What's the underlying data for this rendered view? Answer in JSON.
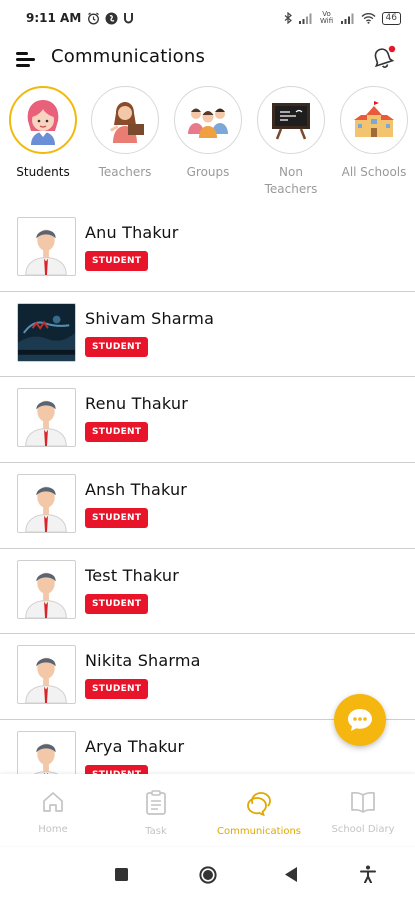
{
  "status_bar": {
    "time": "9:11 AM",
    "left_icons": [
      "alarm-icon",
      "shazam-icon",
      "u-icon"
    ],
    "right_icons": [
      "bluetooth-icon",
      "signal-icon",
      "vowifi-icon",
      "signal-icon",
      "wifi-icon"
    ],
    "vowifi_label": "Vo Wifi",
    "battery": "46"
  },
  "header": {
    "title": "Communications",
    "menu_icon": "hamburger-icon",
    "bell_icon": "bell-icon",
    "accent_dot": "#e8152a"
  },
  "categories": [
    {
      "label": "Students",
      "active": true,
      "icon": "student-girl-icon"
    },
    {
      "label": "Teachers",
      "active": false,
      "icon": "teacher-icon"
    },
    {
      "label": "Groups",
      "active": false,
      "icon": "group-icon"
    },
    {
      "label": "Non Teachers",
      "active": false,
      "icon": "blackboard-icon"
    },
    {
      "label": "All Schools",
      "active": false,
      "icon": "school-building-icon"
    }
  ],
  "list": [
    {
      "name": "Anu Thakur",
      "badge": "STUDENT",
      "avatar": "boy-avatar"
    },
    {
      "name": "Shivam Sharma",
      "badge": "STUDENT",
      "avatar": "photo-avatar"
    },
    {
      "name": "Renu Thakur",
      "badge": "STUDENT",
      "avatar": "boy-avatar"
    },
    {
      "name": "Ansh Thakur",
      "badge": "STUDENT",
      "avatar": "boy-avatar"
    },
    {
      "name": "Test Thakur",
      "badge": "STUDENT",
      "avatar": "boy-avatar"
    },
    {
      "name": "Nikita Sharma",
      "badge": "STUDENT",
      "avatar": "boy-avatar"
    },
    {
      "name": "Arya Thakur",
      "badge": "STUDENT",
      "avatar": "boy-avatar"
    }
  ],
  "fab": {
    "icon": "chat-bubble-icon"
  },
  "bottom_nav": [
    {
      "label": "Home",
      "icon": "home-icon",
      "active": false
    },
    {
      "label": "Task",
      "icon": "clipboard-icon",
      "active": false
    },
    {
      "label": "Communications",
      "icon": "chat-icon",
      "active": true
    },
    {
      "label": "School Diary",
      "icon": "book-icon",
      "active": false
    }
  ],
  "colors": {
    "accent": "#f5b70f",
    "badge": "#e8152a",
    "inactive": "#c4c4c4"
  },
  "system_nav": [
    "recents-square-icon",
    "home-circle-icon",
    "back-triangle-icon",
    "accessibility-icon"
  ]
}
